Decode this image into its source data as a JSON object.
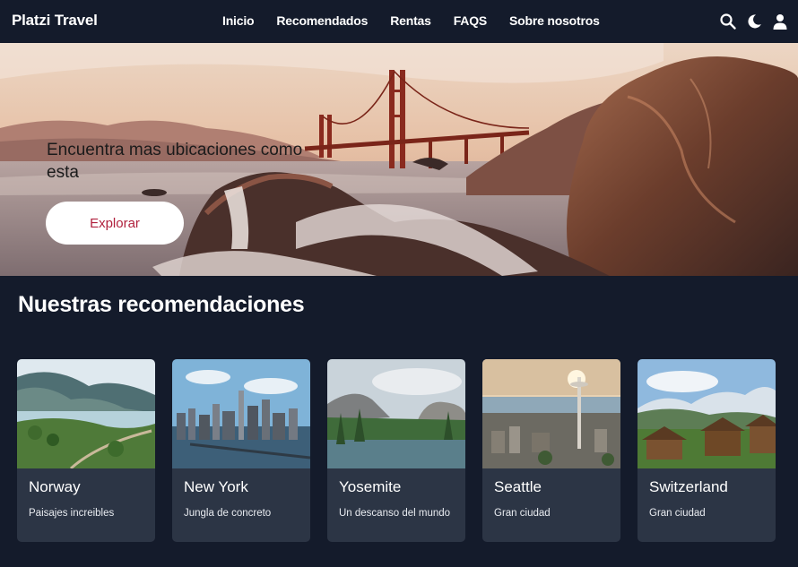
{
  "nav": {
    "brand": "Platzi Travel",
    "items": [
      "Inicio",
      "Recomendados",
      "Rentas",
      "FAQS",
      "Sobre nosotros"
    ],
    "icons": [
      "search-icon",
      "moon-icon",
      "user-icon"
    ]
  },
  "hero": {
    "headline": "Encuentra mas ubicaciones como esta",
    "button_label": "Explorar"
  },
  "recommendations": {
    "title": "Nuestras recomendaciones",
    "cards": [
      {
        "title": "Norway",
        "description": "Paisajes increibles"
      },
      {
        "title": "New York",
        "description": "Jungla de concreto"
      },
      {
        "title": "Yosemite",
        "description": "Un descanso del mundo"
      },
      {
        "title": "Seattle",
        "description": "Gran ciudad"
      },
      {
        "title": "Switzerland",
        "description": "Gran ciudad"
      }
    ]
  },
  "colors": {
    "background": "#141b2b",
    "card": "#2c3545",
    "button_text": "#b0213d"
  }
}
